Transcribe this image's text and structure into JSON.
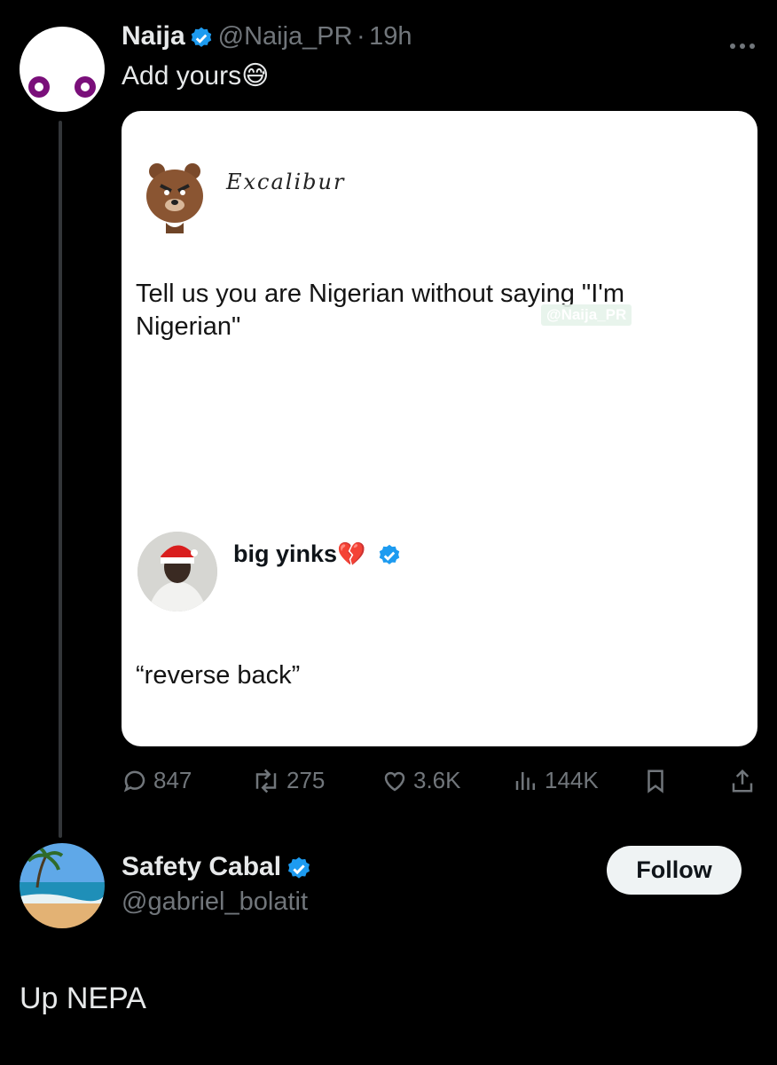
{
  "tweet": {
    "author_name": "Naija",
    "author_handle": "@Naija_PR",
    "separator": "·",
    "time": "19h",
    "text": "Add yours",
    "text_emoji": "😅",
    "more_icon": "more-horizontal-icon"
  },
  "card": {
    "inner_author": "Excalibur",
    "inner_text": "Tell us you are Nigerian without saying \"I'm Nigerian\"",
    "watermark": "@Naija_PR",
    "reply_author": "big yinks",
    "reply_emoji": "💔",
    "reply_text": "“reverse back”"
  },
  "actions": {
    "replies": "847",
    "reposts": "275",
    "likes": "3.6K",
    "views": "144K"
  },
  "reply": {
    "author_name": "Safety Cabal",
    "author_handle": "@gabriel_bolatit",
    "follow_label": "Follow",
    "text": "Up NEPA"
  },
  "colors": {
    "background": "#000000",
    "text_primary": "#e7e9ea",
    "text_secondary": "#71767b",
    "verified_blue": "#1d9bf0",
    "avatar_eye_purple": "#7a0f7a"
  }
}
